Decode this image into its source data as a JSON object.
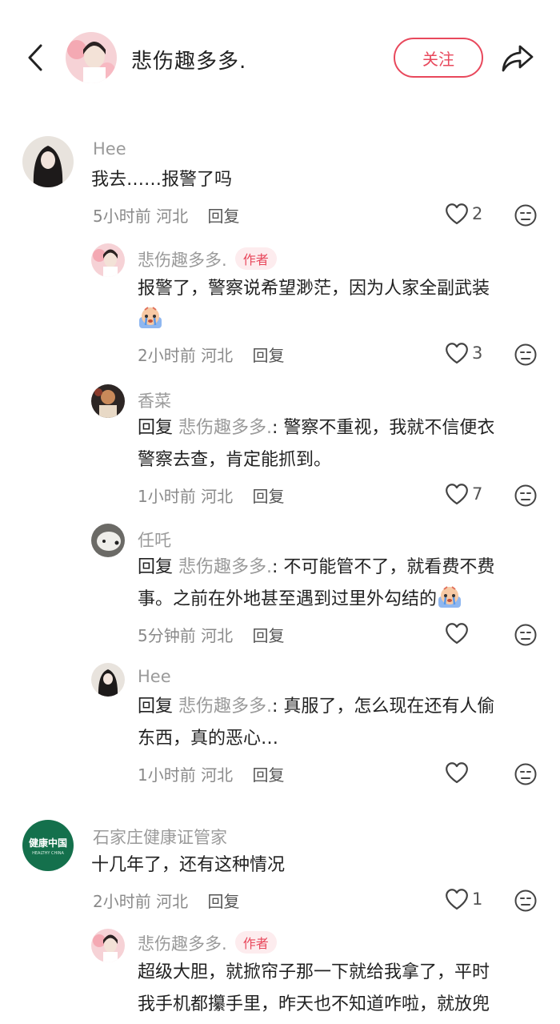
{
  "header": {
    "title": "悲伤趣多多.",
    "follow_label": "关注"
  },
  "colors": {
    "accent": "#e8485c",
    "muted": "#9a9a9a"
  },
  "comments": [
    {
      "author": "Hee",
      "text": "我去……报警了吗",
      "time": "5小时前",
      "location": "河北",
      "reply_label": "回复",
      "likes": "2"
    },
    {
      "author": "悲伤趣多多.",
      "tag": "作者",
      "text": "报警了，警察说希望渺茫，因为人家全副武装",
      "time": "2小时前",
      "location": "河北",
      "reply_label": "回复",
      "likes": "3"
    },
    {
      "author": "香菜",
      "reply_word": "回复",
      "reply_target": "悲伤趣多多.",
      "text_line1": ": 警察不重视，我就不信便衣",
      "text_line2": "警察去查，肯定能抓到。",
      "time": "1小时前",
      "location": "河北",
      "reply_label": "回复",
      "likes": "7"
    },
    {
      "author": "任吒",
      "reply_word": "回复",
      "reply_target": "悲伤趣多多.",
      "text_line1": ": 不可能管不了，就看费不费",
      "text_line2": "事。之前在外地甚至遇到过里外勾结的",
      "time": "5分钟前",
      "location": "河北",
      "reply_label": "回复",
      "likes": ""
    },
    {
      "author": "Hee",
      "reply_word": "回复",
      "reply_target": "悲伤趣多多.",
      "text_line1": ": 真服了，怎么现在还有人偷",
      "text_line2": "东西，真的恶心…",
      "time": "1小时前",
      "location": "河北",
      "reply_label": "回复",
      "likes": ""
    },
    {
      "author": "石家庄健康证管家",
      "avatar_text": "健康中国",
      "avatar_subtext": "HEALTHY CHINA",
      "text": "十几年了，还有这种情况",
      "time": "2小时前",
      "location": "河北",
      "reply_label": "回复",
      "likes": "1"
    },
    {
      "author": "悲伤趣多多.",
      "tag": "作者",
      "text_line1": "超级大胆，就掀帘子那一下就给我拿了，平时",
      "text_line2": "我手机都攥手里，昨天也不知道咋啦，就放兜"
    }
  ]
}
